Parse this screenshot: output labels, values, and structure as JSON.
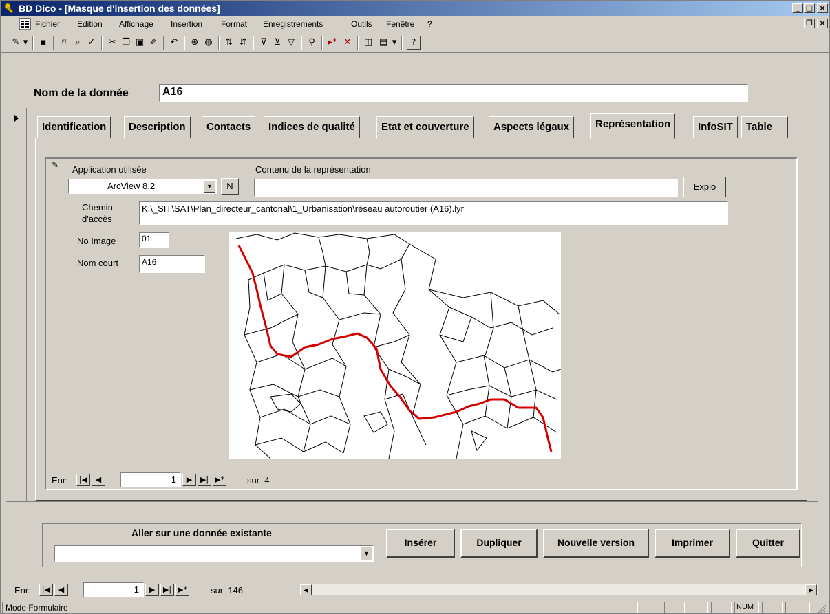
{
  "window": {
    "title": "BD Dico - [Masque d'insertion des données]",
    "min_glyph": "_",
    "max_glyph": "□",
    "close_glyph": "×",
    "restore_glyph": "❐"
  },
  "menu": [
    "Fichier",
    "Edition",
    "Affichage",
    "Insertion",
    "Format",
    "Enregistrements",
    "Outils",
    "Fenêtre",
    "?"
  ],
  "toolbar_icons": [
    "design-view-icon",
    "dropdown-icon",
    "save-icon",
    "print-icon",
    "print-preview-icon",
    "spelling-icon",
    "cut-icon",
    "copy-icon",
    "paste-icon",
    "format-painter-icon",
    "undo-icon",
    "insert-hyperlink-icon",
    "web-toolbar-icon",
    "sort-ascending-icon",
    "sort-descending-icon",
    "filter-by-selection-icon",
    "filter-by-form-icon",
    "apply-filter-icon",
    "find-icon",
    "new-record-icon",
    "delete-record-icon",
    "database-window-icon",
    "new-object-icon",
    "help-icon"
  ],
  "form": {
    "nom_label": "Nom de la donnée",
    "nom_value": "A16"
  },
  "tabs": [
    "Identification",
    "Description",
    "Contacts",
    "Indices de qualité",
    "Etat et couverture",
    "Aspects légaux",
    "Représentation",
    "InfoSIT",
    "Table"
  ],
  "active_tab": "Représentation",
  "subform": {
    "application_label": "Application utilisée",
    "application_value": "ArcView 8.2",
    "n_button": "N",
    "contenu_label": "Contenu de la représentation",
    "contenu_value": "",
    "explo_button": "Explo",
    "chemin_label_1": "Chemin",
    "chemin_label_2": "d'accès",
    "chemin_value": "K:\\_SIT\\SAT\\Plan_directeur_cantonal\\1_Urbanisation\\réseau autoroutier (A16).lyr",
    "noimage_label": "No Image",
    "noimage_value": "01",
    "nomcourt_label": "Nom court",
    "nomcourt_value": "A16",
    "nav_label": "Enr:",
    "nav_record": "1",
    "nav_of": "sur  4"
  },
  "bottom": {
    "goto_label": "Aller sur une donnée existante",
    "goto_value": "",
    "buttons": [
      "Insérer",
      "Dupliquer",
      "Nouvelle version",
      "Imprimer",
      "Quitter"
    ]
  },
  "main_nav": {
    "label": "Enr:",
    "record": "1",
    "of": "sur  146"
  },
  "status": {
    "mode": "Mode Formulaire",
    "num": "NUM"
  },
  "colors": {
    "titlebar_start": "#0a246a",
    "titlebar_end": "#a6caf0",
    "window_face": "#d4d0c8",
    "route": "#d40000"
  }
}
